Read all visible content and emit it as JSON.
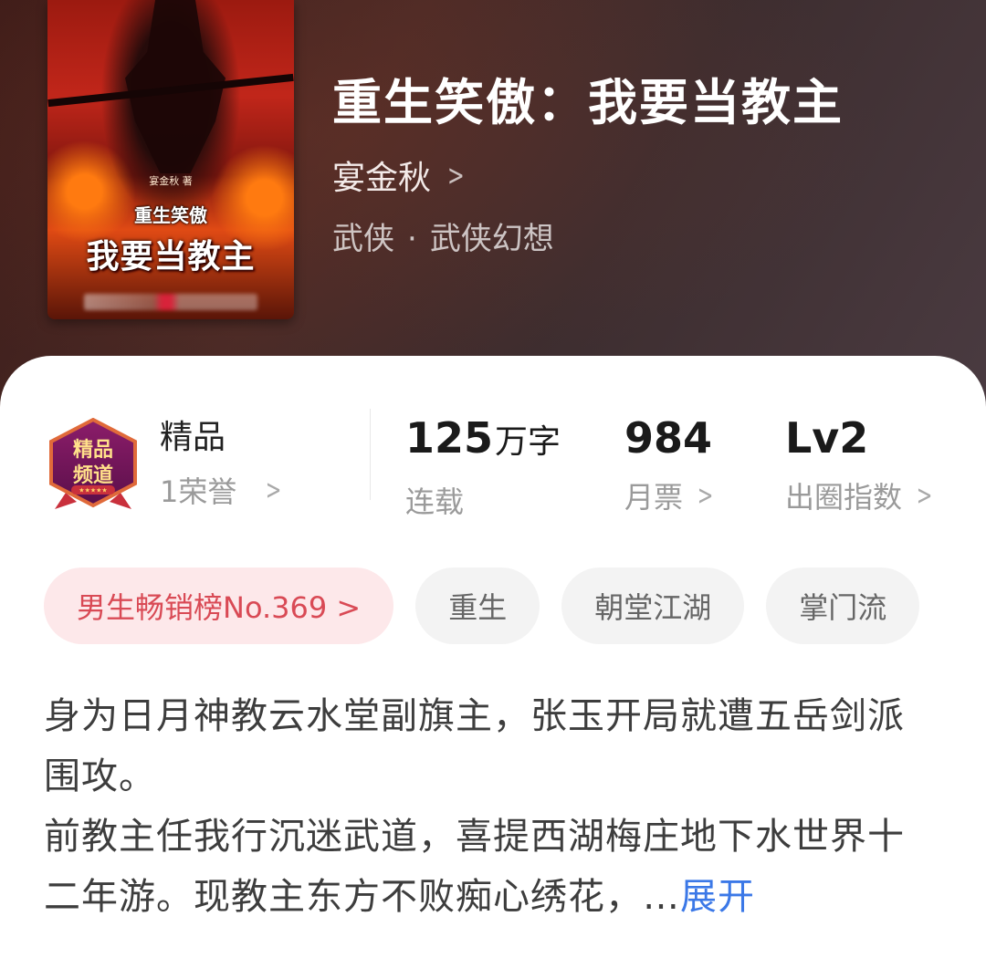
{
  "book": {
    "cover": {
      "author_note": "宴金秋 著",
      "subtitle": "重生笑傲",
      "title": "我要当教主"
    },
    "title": "重生笑傲：我要当教主",
    "author": "宴金秋",
    "category": "武侠",
    "subcategory": "武侠幻想",
    "genre_separator": "·"
  },
  "quality": {
    "badge_line1": "精品",
    "badge_line2": "频道",
    "badge_icon": "boutique-channel-badge",
    "title": "精品",
    "honors": "1荣誉"
  },
  "stats": {
    "words_value": "125",
    "words_unit": "万字",
    "status": "连载",
    "tickets_value": "984",
    "tickets_label": "月票",
    "index_value": "Lv2",
    "index_label": "出圈指数"
  },
  "tags": {
    "rank": "男生畅销榜No.369 >",
    "items": [
      "重生",
      "朝堂江湖",
      "掌门流"
    ]
  },
  "description": {
    "paragraph1": "身为日月神教云水堂副旗主，张玉开局就遭五岳剑派围攻。",
    "paragraph2": "前教主任我行沉迷武道，喜提西湖梅庄地下水世界十二年游。现教主东方不败痴心绣花，…",
    "expand_label": "展开"
  },
  "colors": {
    "accent_link": "#3b78e7",
    "rank_text": "#d94a55",
    "rank_bg": "#fde8ea"
  }
}
